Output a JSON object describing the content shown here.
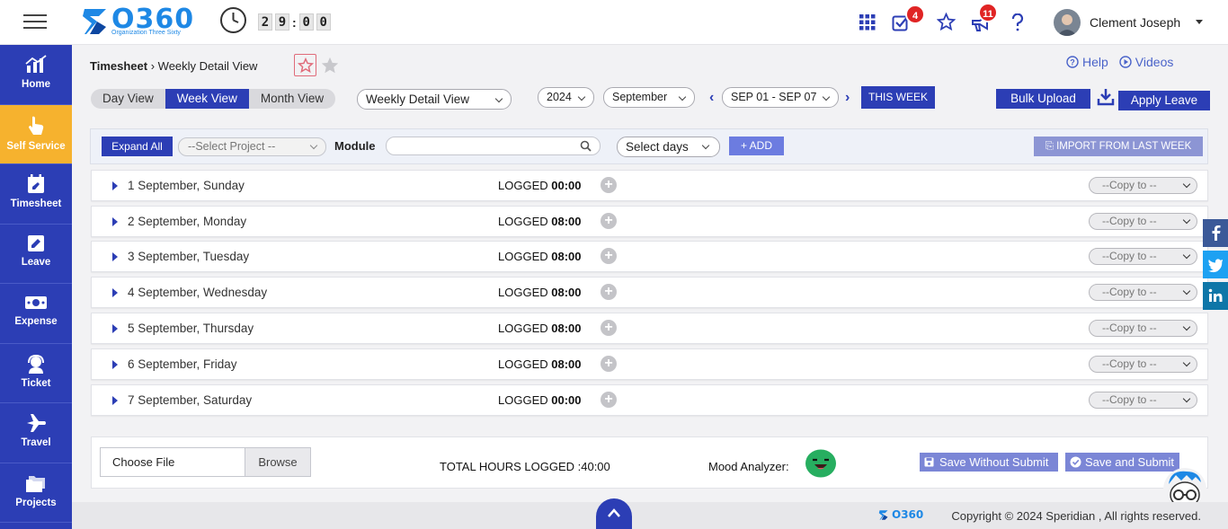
{
  "app": {
    "logo_text": "O360",
    "logo_sub": "Organization Three Sixty"
  },
  "timer": {
    "digits": [
      "2",
      "9",
      "0",
      "0"
    ]
  },
  "header": {
    "tasks_badge": "4",
    "announce_badge": "11",
    "user_name": "Clement Joseph"
  },
  "sidebar": {
    "items": [
      {
        "label": "Home",
        "icon": "chart-icon"
      },
      {
        "label": "Self Service",
        "icon": "hand-pointer-icon"
      },
      {
        "label": "Timesheet",
        "icon": "calendar-edit-icon"
      },
      {
        "label": "Leave",
        "icon": "edit-square-icon"
      },
      {
        "label": "Expense",
        "icon": "money-icon"
      },
      {
        "label": "Ticket",
        "icon": "headset-icon"
      },
      {
        "label": "Travel",
        "icon": "plane-icon"
      },
      {
        "label": "Projects",
        "icon": "folders-icon"
      }
    ]
  },
  "breadcrumb": {
    "root": "Timesheet",
    "current": "Weekly Detail View"
  },
  "help": {
    "help_label": "Help",
    "videos_label": "Videos"
  },
  "views": {
    "day": "Day View",
    "week": "Week View",
    "month": "Month View"
  },
  "view_select": "Weekly Detail View",
  "year_select": "2024",
  "month_select": "September",
  "week_select": "SEP 01 - SEP 07",
  "this_week_label": "THIS WEEK",
  "bulk_upload_label": "Bulk Upload",
  "apply_leave_label": "Apply Leave",
  "filters": {
    "expand_all": "Expand All",
    "select_project": "--Select Project --",
    "module_label": "Module",
    "module_value": "",
    "select_days": "Select days",
    "add_label": "ADD",
    "import_label": "IMPORT FROM LAST WEEK"
  },
  "logged_label": "LOGGED",
  "copy_placeholder": "--Copy to --",
  "days": [
    {
      "name": "1 September, Sunday",
      "hours": "00:00"
    },
    {
      "name": "2 September, Monday",
      "hours": "08:00"
    },
    {
      "name": "3 September, Tuesday",
      "hours": "08:00"
    },
    {
      "name": "4 September, Wednesday",
      "hours": "08:00"
    },
    {
      "name": "5 September, Thursday",
      "hours": "08:00"
    },
    {
      "name": "6 September, Friday",
      "hours": "08:00"
    },
    {
      "name": "7 September, Saturday",
      "hours": "00:00"
    }
  ],
  "bottom": {
    "choose_file": "Choose File",
    "browse": "Browse",
    "total_hours": "TOTAL HOURS LOGGED  :40:00",
    "mood_label": "Mood Analyzer:",
    "save_without_submit": "Save Without Submit",
    "save_and_submit": "Save and Submit"
  },
  "footer": {
    "copyright": "Copyright © 2024 Speridian , All rights reserved.",
    "logo_text": "O360"
  },
  "colors": {
    "primary": "#2c3eb5",
    "active": "#f6b22e",
    "badge": "#e02424"
  }
}
